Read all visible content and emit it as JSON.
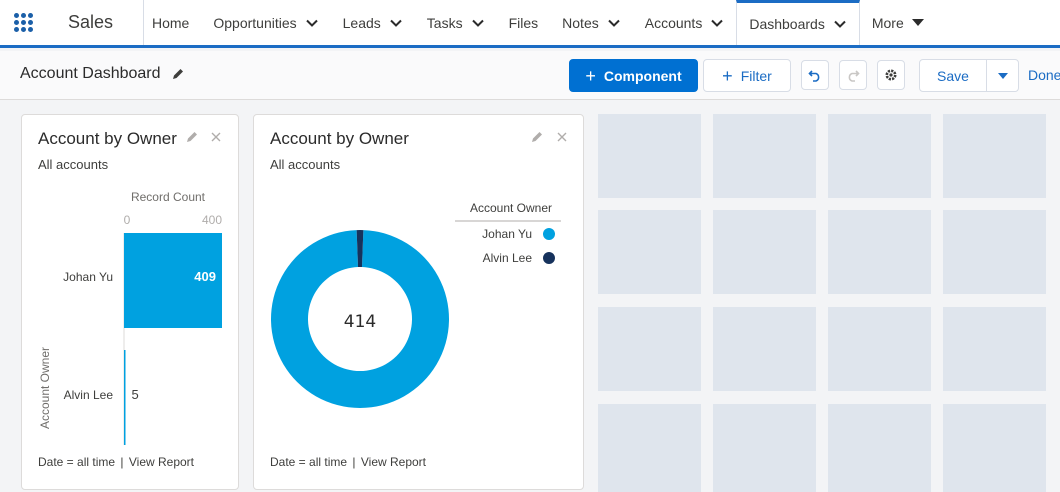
{
  "nav": {
    "app_name": "Sales",
    "items": [
      {
        "label": "Home",
        "chevron": false
      },
      {
        "label": "Opportunities",
        "chevron": true
      },
      {
        "label": "Leads",
        "chevron": true
      },
      {
        "label": "Tasks",
        "chevron": true
      },
      {
        "label": "Files",
        "chevron": false
      },
      {
        "label": "Notes",
        "chevron": true
      },
      {
        "label": "Accounts",
        "chevron": true
      },
      {
        "label": "Dashboards",
        "chevron": true,
        "active": true
      },
      {
        "label": "More",
        "caret": true
      }
    ]
  },
  "header": {
    "title": "Account Dashboard",
    "add_component": "Component",
    "add_filter": "Filter",
    "save": "Save",
    "done": "Done"
  },
  "colors": {
    "accent": "#0070d2",
    "johan": "#00a1e0",
    "alvin": "#16325c",
    "placeholder": "#dfe5ed"
  },
  "widget_bar": {
    "title": "Account by Owner",
    "subtitle": "All accounts",
    "footer_filter": "Date = all time",
    "footer_sep": "|",
    "footer_link": "View Report",
    "chart_data": {
      "type": "bar",
      "orientation": "horizontal",
      "xlabel": "Record Count",
      "ylabel": "Account Owner",
      "xlim": [
        0,
        400
      ],
      "ticks": [
        "0",
        "400"
      ],
      "categories": [
        "Johan Yu",
        "Alvin Lee"
      ],
      "values": [
        409,
        5
      ]
    }
  },
  "widget_donut": {
    "title": "Account by Owner",
    "subtitle": "All accounts",
    "footer_filter": "Date = all time",
    "footer_sep": "|",
    "footer_link": "View Report",
    "chart_data": {
      "type": "pie",
      "variant": "donut",
      "total_label": "414",
      "legend_title": "Account Owner",
      "legend_position": "right",
      "categories": [
        "Johan Yu",
        "Alvin Lee"
      ],
      "values": [
        409,
        5
      ]
    }
  }
}
